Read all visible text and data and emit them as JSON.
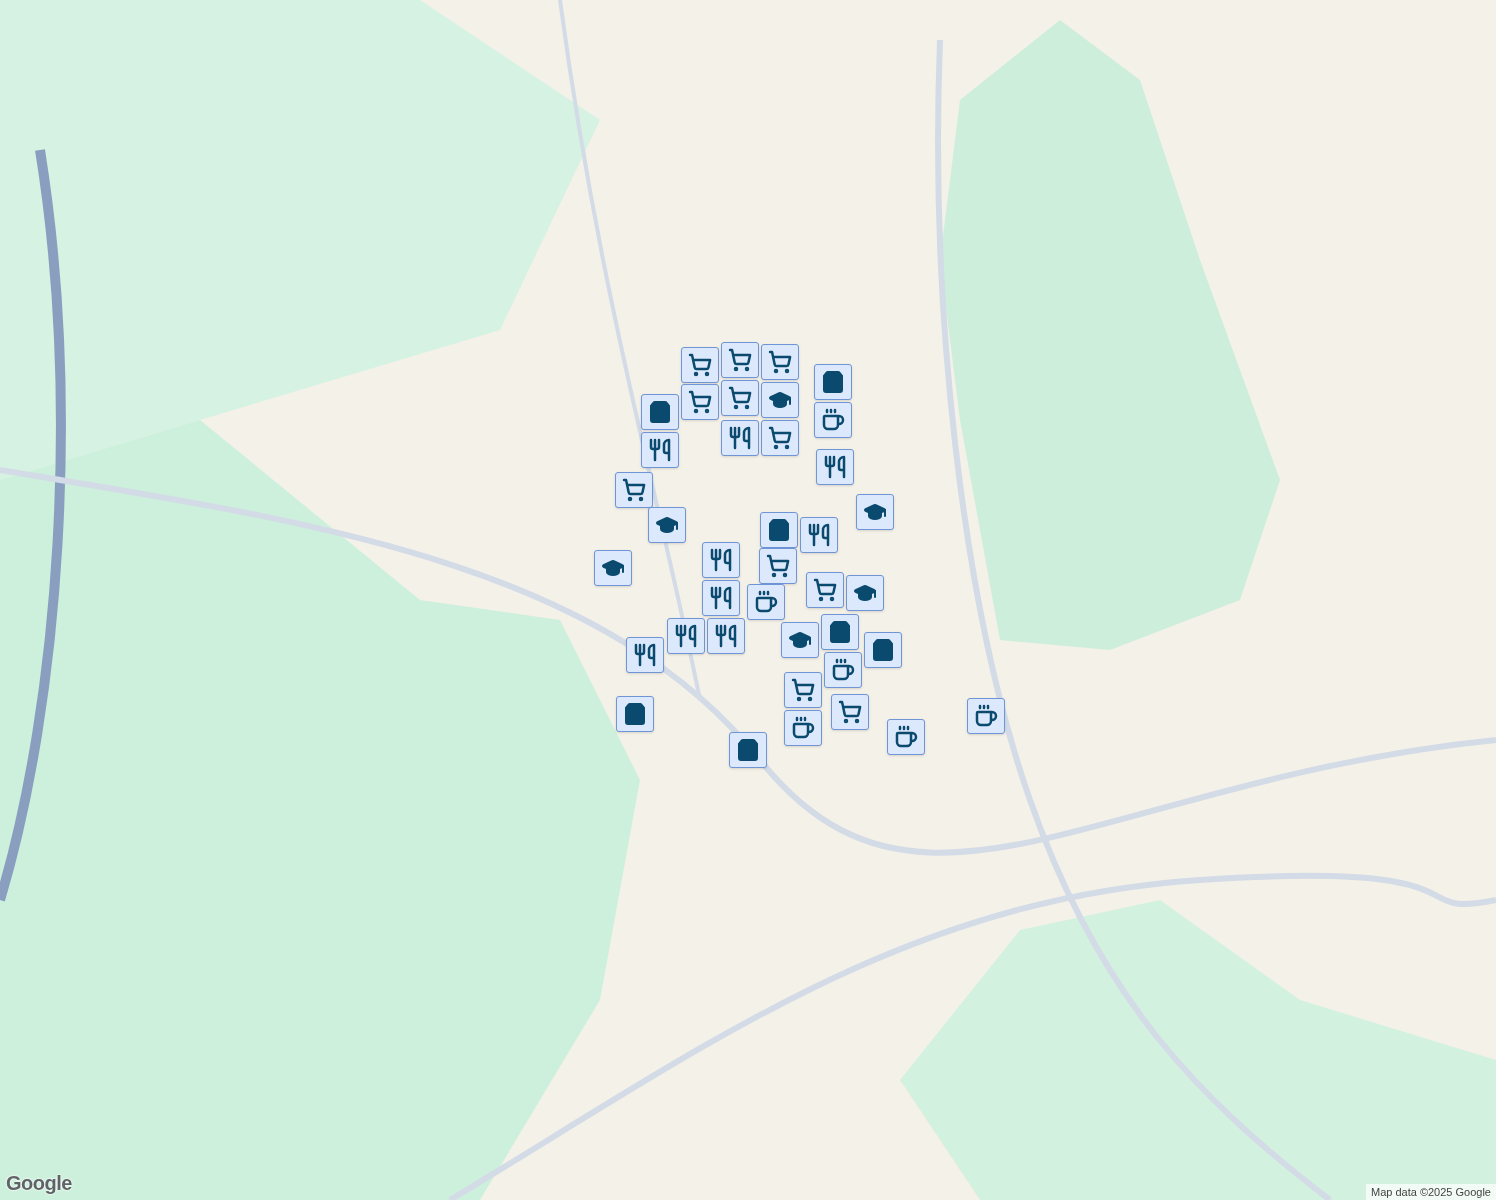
{
  "markers": [
    {
      "kind": "grocery"
    },
    {
      "kind": "grocery"
    },
    {
      "kind": "grocery"
    },
    {
      "kind": "grocery"
    },
    {
      "kind": "grocery"
    },
    {
      "kind": "school"
    },
    {
      "kind": "grocery"
    },
    {
      "kind": "restaurant"
    },
    {
      "kind": "shop"
    },
    {
      "kind": "restaurant"
    },
    {
      "kind": "shop"
    },
    {
      "kind": "cafe"
    },
    {
      "kind": "restaurant"
    },
    {
      "kind": "grocery"
    },
    {
      "kind": "school"
    },
    {
      "kind": "school"
    },
    {
      "kind": "school"
    },
    {
      "kind": "shop"
    },
    {
      "kind": "restaurant"
    },
    {
      "kind": "restaurant"
    },
    {
      "kind": "grocery"
    },
    {
      "kind": "restaurant"
    },
    {
      "kind": "cafe"
    },
    {
      "kind": "grocery"
    },
    {
      "kind": "school"
    },
    {
      "kind": "restaurant"
    },
    {
      "kind": "restaurant"
    },
    {
      "kind": "school"
    },
    {
      "kind": "shop"
    },
    {
      "kind": "cafe"
    },
    {
      "kind": "shop"
    },
    {
      "kind": "restaurant"
    },
    {
      "kind": "grocery"
    },
    {
      "kind": "cafe"
    },
    {
      "kind": "grocery"
    },
    {
      "kind": "shop"
    },
    {
      "kind": "shop"
    },
    {
      "kind": "cafe"
    },
    {
      "kind": "cafe"
    }
  ],
  "logo": "Google",
  "attribution": "Map data ©2025 Google"
}
